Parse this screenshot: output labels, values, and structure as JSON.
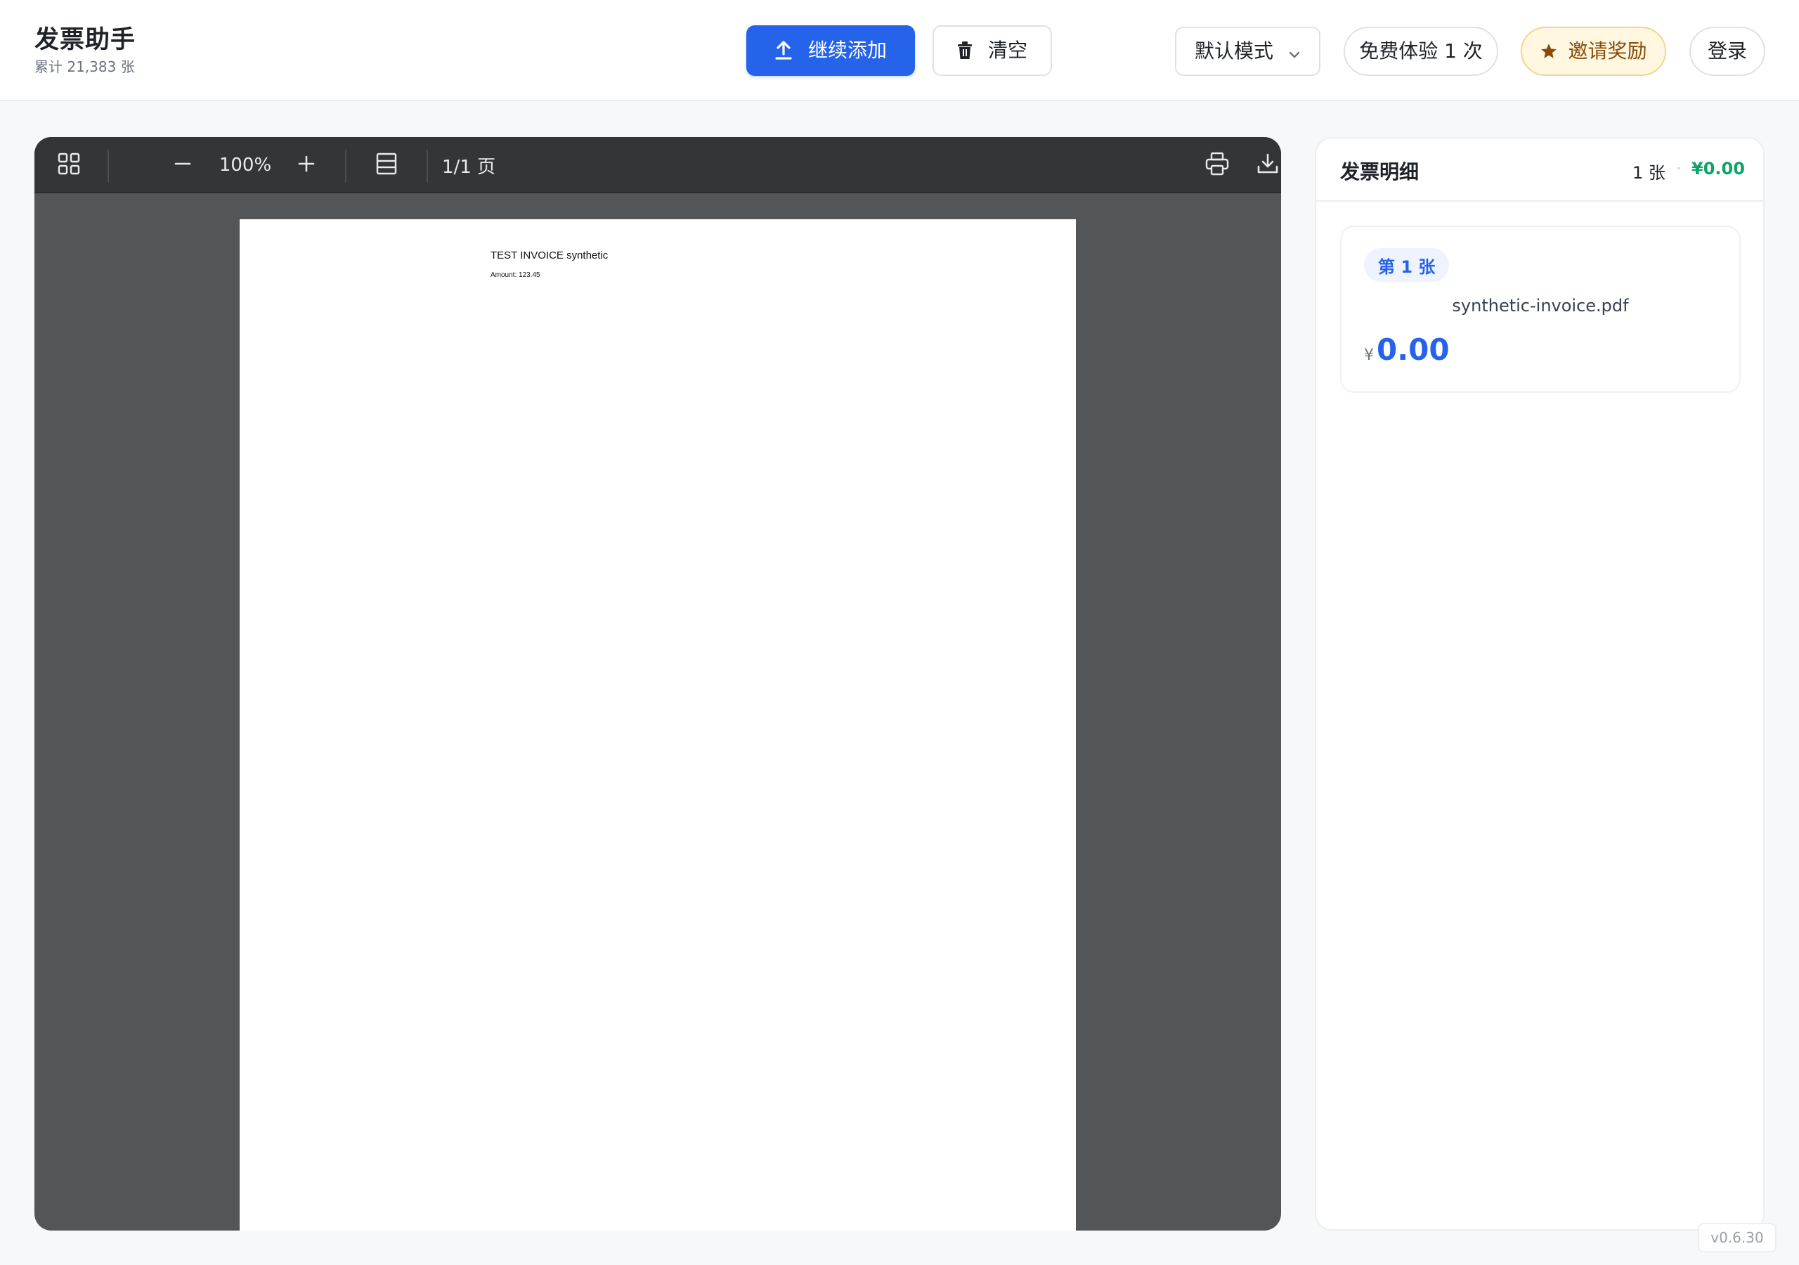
{
  "app": {
    "title": "发票助手",
    "subtitle": "累计 21,383 张",
    "version": "v0.6.30"
  },
  "toolbar": {
    "add_label": "继续添加",
    "clear_label": "清空",
    "mode_label": "默认模式",
    "trial_label": "免费体验 1 次",
    "invite_label": "邀请奖励",
    "login_label": "登录"
  },
  "viewer": {
    "zoom": "100%",
    "page_indicator": "1/1 页",
    "document": {
      "title": "TEST INVOICE synthetic",
      "amount_line": "Amount: 123.45"
    }
  },
  "panel": {
    "title": "发票明细",
    "count": "1 张",
    "separator": "·",
    "total": "¥0.00",
    "items": [
      {
        "badge": "第 1 张",
        "filename": "synthetic-invoice.pdf",
        "currency": "¥",
        "amount": "0.00"
      }
    ]
  },
  "colors": {
    "accent": "#2563eb",
    "total_green": "#10a266",
    "viewer_bg": "#525659",
    "toolbar_bg": "#323639",
    "invite_bg": "#fff7e0"
  },
  "icons": [
    "upload-icon",
    "trash-icon",
    "chevron-down-icon",
    "star-icon",
    "grid-icon",
    "zoom-out-icon",
    "zoom-in-icon",
    "page-layout-icon",
    "print-icon",
    "download-icon"
  ]
}
